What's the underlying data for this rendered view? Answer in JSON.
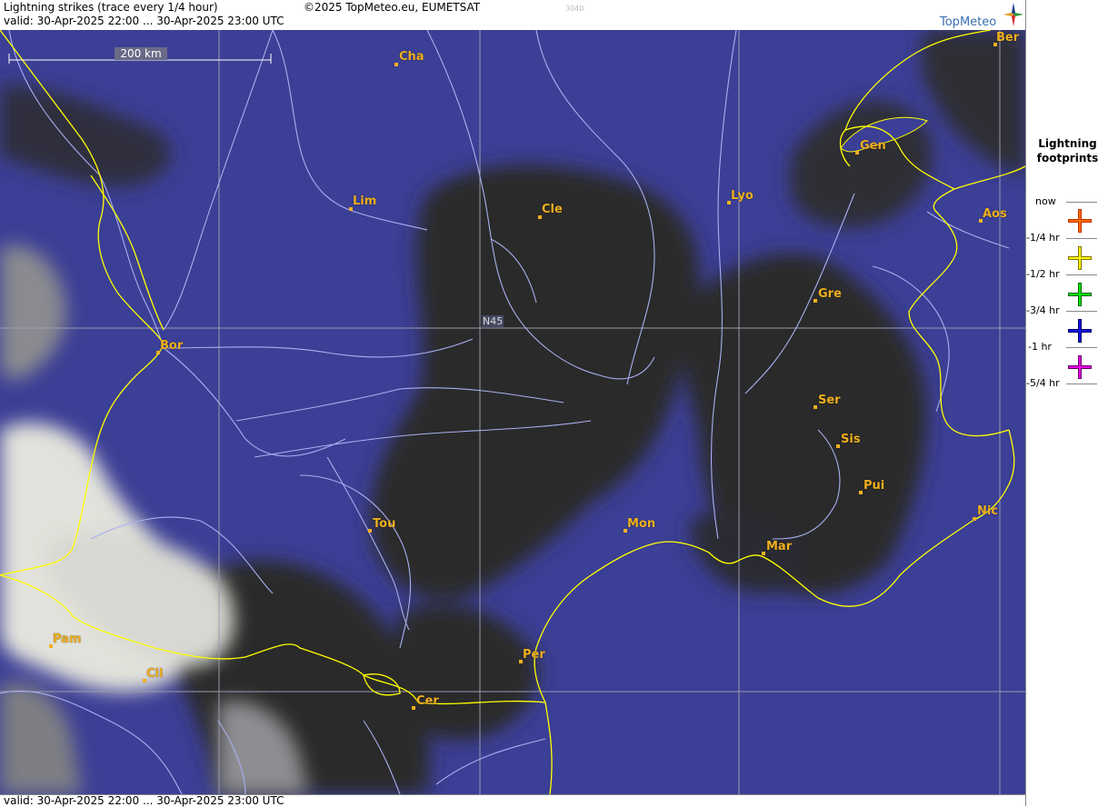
{
  "header": {
    "title": "Lightning strikes (trace every 1/4 hour)",
    "copyright": "©2025 TopMeteo.eu, EUMETSAT",
    "watermark": "3040",
    "valid_top": "valid:  30-Apr-2025 22:00 ... 30-Apr-2025 23:00 UTC",
    "logo_text": "TopMeteo"
  },
  "footer": {
    "valid_bottom": "valid:  30-Apr-2025 22:00 ... 30-Apr-2025 23:00 UTC"
  },
  "map": {
    "scale_label": "200 km",
    "lat_label": "N45",
    "cities": [
      "Cha",
      "Ber",
      "Gen",
      "Lim",
      "Cle",
      "Lyo",
      "Aos",
      "Gre",
      "Bor",
      "Ser",
      "Sis",
      "Pui",
      "Tou",
      "Mon",
      "Mar",
      "Nic",
      "Pam",
      "Per",
      "Cil",
      "Cer"
    ]
  },
  "legend": {
    "title_line1": "Lightning",
    "title_line2": "footprints",
    "items": [
      {
        "label": "now",
        "color": "#ff4400"
      },
      {
        "label": "-1/4 hr",
        "color": "#ffff00"
      },
      {
        "label": "-1/2 hr",
        "color": "#00ee00"
      },
      {
        "label": "-3/4 hr",
        "color": "#0000ee"
      },
      {
        "label": "-1 hr",
        "color": "#ee00ee"
      },
      {
        "label": "-5/4 hr",
        "color": null
      }
    ]
  },
  "colors": {
    "sea_land_background": "#3b3f95",
    "clouds_dark": "#2b2b2b",
    "clouds_bright": "#e6e6e0",
    "borders": "#ffff00",
    "rivers": "#a8b0f0",
    "grid": "#9a9ab0",
    "city_labels": "#f0b020"
  }
}
